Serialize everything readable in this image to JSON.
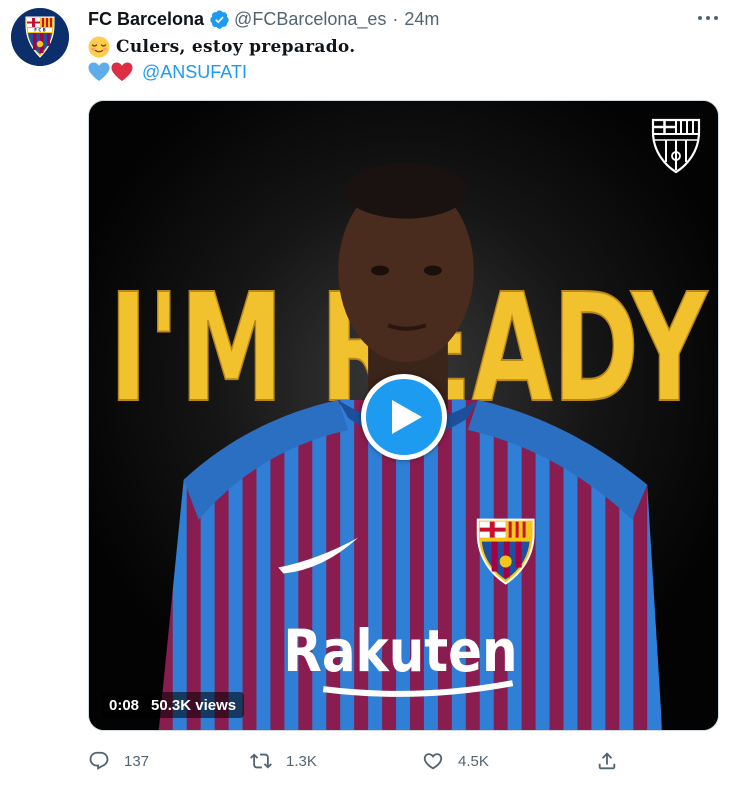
{
  "author": {
    "display_name": "FC Barcelona",
    "handle": "@FCBarcelona_es",
    "separator": "·",
    "time": "24m",
    "avatar_icon": "fcb-crest-icon",
    "verified_icon": "verified-badge-icon"
  },
  "tweet": {
    "text": "Culers, estoy preparado.",
    "leading_emoji": "relieved-face-emoji",
    "hearts": [
      "blue-heart-emoji",
      "red-heart-emoji"
    ],
    "mention": "@ANSUFATI"
  },
  "media": {
    "type": "video",
    "duration": "0:08",
    "views": "50.3K views",
    "overlay_text": "I'M READY",
    "play_icon": "play-icon"
  },
  "actions": {
    "reply": {
      "icon": "reply-icon",
      "count": "137"
    },
    "retweet": {
      "icon": "retweet-icon",
      "count": "1.3K"
    },
    "like": {
      "icon": "heart-icon",
      "count": "4.5K"
    },
    "share": {
      "icon": "share-icon"
    }
  },
  "colors": {
    "accent": "#1d9bf0",
    "text": "#0f1419",
    "muted": "#536471",
    "overlay_gold": "#f2c12e",
    "jersey_blue": "#2f7fd6",
    "jersey_garnet": "#8a1d4f"
  }
}
